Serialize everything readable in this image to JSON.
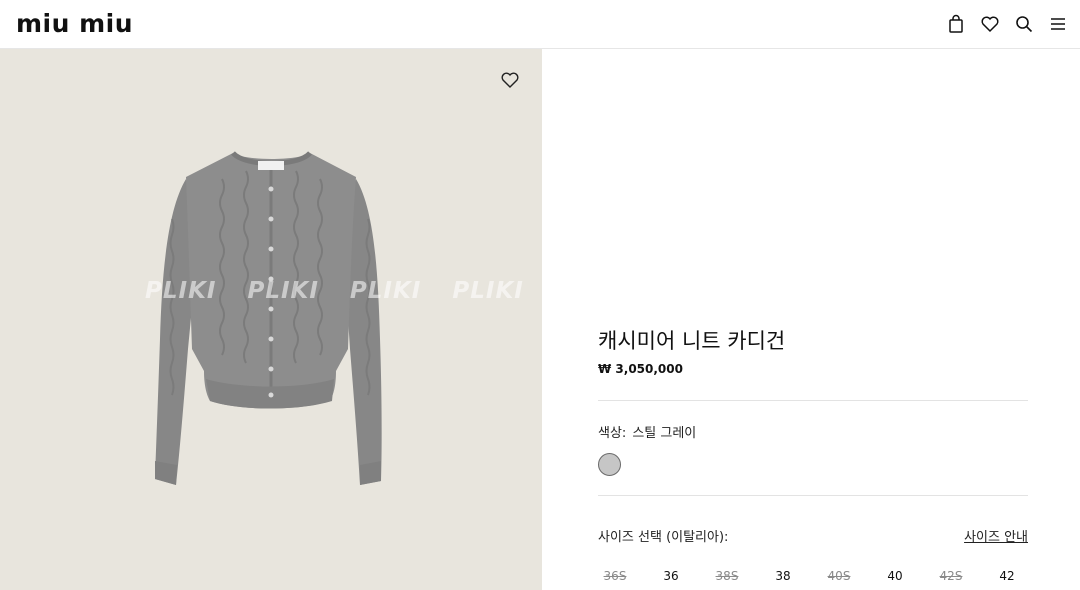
{
  "header": {
    "logo": "miu miu",
    "icons": [
      "bag-icon",
      "heart-icon",
      "search-icon",
      "menu-icon"
    ]
  },
  "product": {
    "watermark": "PLIKI PLIKI PLIKI PLIKI PL",
    "title": "캐시미어 니트 카디건",
    "price": "₩ 3,050,000",
    "color_label": "색상:",
    "color_value": "스틸 그레이",
    "swatch_color": "#c6c6c6",
    "size_label": "사이즈 선택 (이탈리아):",
    "size_guide": "사이즈 안내",
    "sizes": [
      {
        "label": "36S",
        "available": false
      },
      {
        "label": "36",
        "available": true
      },
      {
        "label": "38S",
        "available": false
      },
      {
        "label": "38",
        "available": true
      },
      {
        "label": "40S",
        "available": false
      },
      {
        "label": "40",
        "available": true
      },
      {
        "label": "42S",
        "available": false
      },
      {
        "label": "42",
        "available": true
      }
    ]
  },
  "colors": {
    "image_background": "#e8e5dd",
    "garment": "#8c8c8c"
  }
}
